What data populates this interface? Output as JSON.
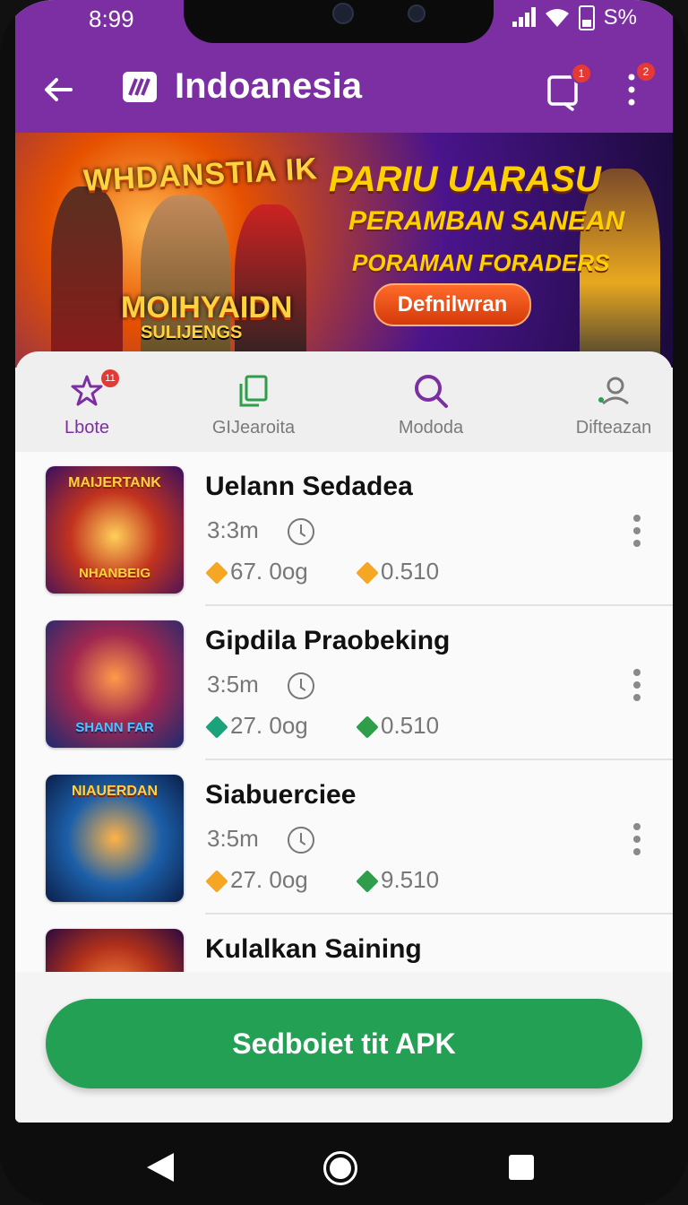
{
  "status": {
    "time": "8:99",
    "battery": "S%"
  },
  "appbar": {
    "title": "Indoanesia",
    "share_badge": "1",
    "menu_badge": "2"
  },
  "banner": {
    "left_title": "WHDANSTIA IK",
    "left_bottom_title": "MOIHYAIDN",
    "left_bottom_sub": "SULIJENGS",
    "headline_1": "PARIU UARASU",
    "headline_2": "PERAMBAN SANEAN",
    "headline_3": "PORAMAN FORADERS",
    "cta_label": "Defnilwran"
  },
  "tabs": [
    {
      "label": "Lbote",
      "icon": "star-icon",
      "badge": "11",
      "active": true
    },
    {
      "label": "GIJearoita",
      "icon": "copy-icon",
      "active": false
    },
    {
      "label": "Mododa",
      "icon": "search-icon",
      "active": false
    },
    {
      "label": "Difteazan",
      "icon": "user-icon",
      "active": false
    }
  ],
  "list": [
    {
      "title": "Uelann Sedadea",
      "time": "3:3m",
      "stat1": "67. 0og",
      "stat2": "0.510",
      "thumb_top": "MAIJERTANK",
      "thumb_bottom": "NHANBEIG",
      "colors": {
        "stat1_gem": "#f5a623",
        "stat2_gem": "#f5a623",
        "thumb_bg": "#c2331e"
      }
    },
    {
      "title": "Gipdila Praobeking",
      "time": "3:5m",
      "stat1": "27. 0og",
      "stat2": "0.510",
      "thumb_top": "",
      "thumb_bottom": "SHANN FAR",
      "colors": {
        "stat1_gem": "#1aa37a",
        "stat2_gem": "#2e9e4a",
        "thumb_bg": "#a0284f"
      }
    },
    {
      "title": "Siabuerciee",
      "time": "3:5m",
      "stat1": "27. 0og",
      "stat2": "9.510",
      "thumb_top": "NIAUERDAN",
      "thumb_bottom": "",
      "colors": {
        "stat1_gem": "#f5a623",
        "stat2_gem": "#2e9e4a",
        "thumb_bg": "#1c5fa8"
      }
    },
    {
      "title": "Kulalkan Saining",
      "time": "",
      "stat1": "",
      "stat2": "",
      "thumb_top": "",
      "thumb_bottom": "",
      "colors": {
        "stat1_gem": "#f5a623",
        "stat2_gem": "#2e9e4a",
        "thumb_bg": "#b0301a"
      }
    }
  ],
  "footer": {
    "button_label": "Sedboiet tit APK"
  },
  "colors": {
    "brand_purple": "#7b2fa3",
    "cta_green": "#24a055",
    "badge_red": "#e53935"
  }
}
